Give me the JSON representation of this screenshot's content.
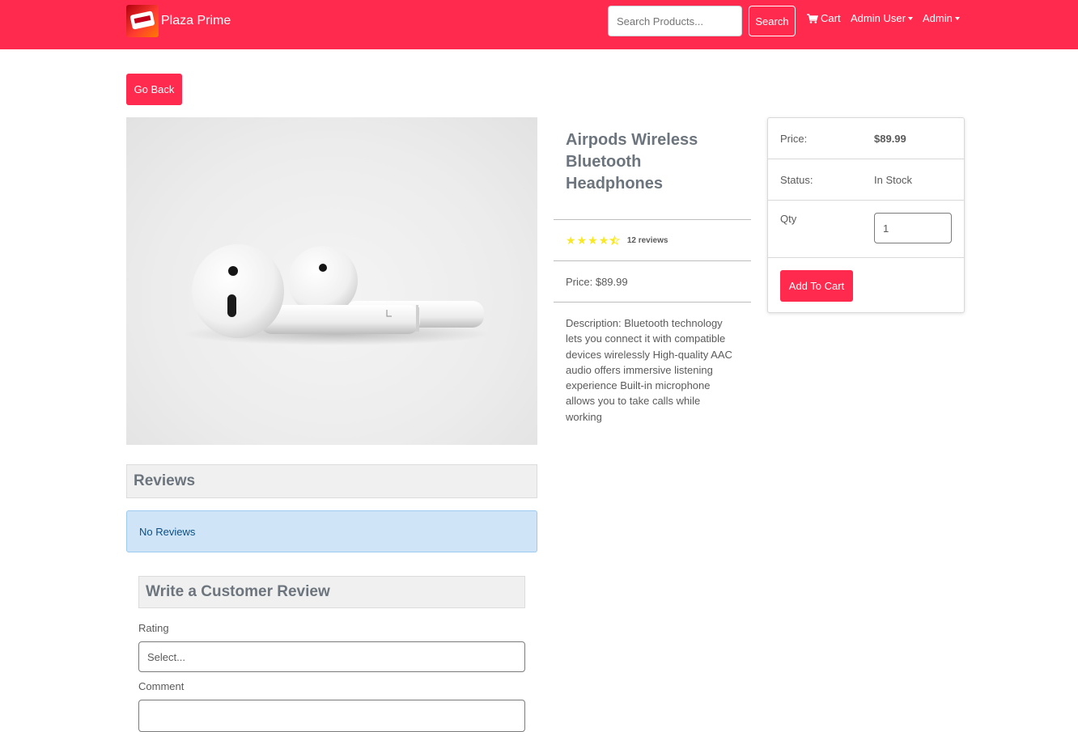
{
  "navbar": {
    "brand": "Plaza Prime",
    "search_placeholder": "Search Products...",
    "search_button": "Search",
    "cart": "Cart",
    "user": "Admin User",
    "admin": "Admin"
  },
  "go_back": "Go Back",
  "product": {
    "title": "Airpods Wireless Bluetooth Headphones",
    "rating": 4.5,
    "reviews_text": "12 reviews",
    "price_line": "Price: $89.99",
    "description": "Description: Bluetooth technology lets you connect it with compatible devices wirelessly High-quality AAC audio offers immersive listening experience Built-in microphone allows you to take calls while working"
  },
  "card": {
    "price_label": "Price:",
    "price_value": "$89.99",
    "status_label": "Status:",
    "status_value": "In Stock",
    "qty_label": "Qty",
    "qty_value": "1",
    "add_to_cart": "Add To Cart"
  },
  "reviews": {
    "heading": "Reviews",
    "empty": "No Reviews",
    "write_heading": "Write a Customer Review",
    "rating_label": "Rating",
    "rating_placeholder": "Select...",
    "comment_label": "Comment"
  },
  "colors": {
    "brand": "#ff2a4d",
    "star": "#f8e825",
    "info_bg": "#cfe5f7"
  }
}
